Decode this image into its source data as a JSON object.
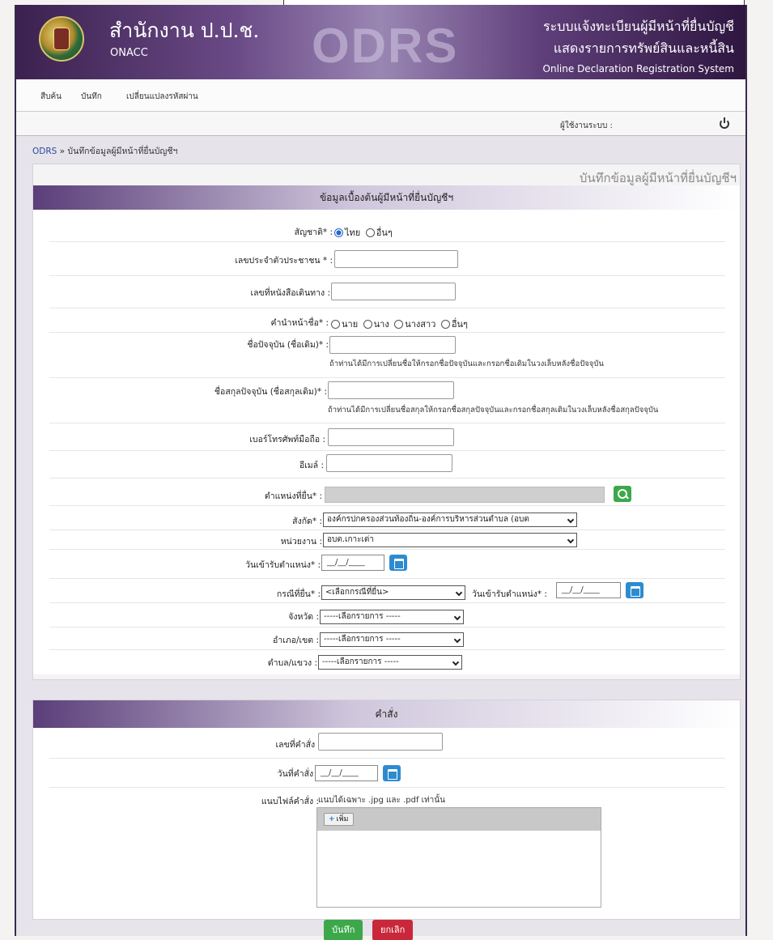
{
  "header": {
    "org_name": "สำนักงาน ป.ป.ช.",
    "org_abbr": "ONACC",
    "app_logo_text": "ODRS",
    "system_line1": "ระบบแจ้งทะเบียนผู้มีหน้าที่ยื่นบัญชี",
    "system_line2": "แสดงรายการทรัพย์สินและหนี้สิน",
    "system_line3": "Online Declaration Registration System"
  },
  "nav": {
    "items": [
      {
        "label": "สืบค้น"
      },
      {
        "label": "บันทึก"
      },
      {
        "label": "เปลี่ยนแปลงรหัสผ่าน"
      }
    ]
  },
  "userbar": {
    "user_label": "ผู้ใช้งานระบบ :"
  },
  "breadcrumb": {
    "home": "ODRS",
    "separator": " » ",
    "current": "บันทึกข้อมูลผู้มีหน้าที่ยื่นบัญชีฯ"
  },
  "page_title": "บันทึกข้อมูลผู้มีหน้าที่ยื่นบัญชีฯ",
  "section1": {
    "title": "ข้อมูลเบื้องต้นผู้มีหน้าที่ยื่นบัญชีฯ",
    "nationality_label": "สัญชาติ* :",
    "nationality_options": [
      "ไทย",
      "อื่นๆ"
    ],
    "id_label": "เลขประจำตัวประชาชน * :",
    "passport_label": "เลขที่หนังสือเดินทาง :",
    "prefix_label": "คำนำหน้าชื่อ* :",
    "prefix_options": [
      "นาย",
      "นาง",
      "นางสาว",
      "อื่นๆ"
    ],
    "firstname_label": "ชื่อปัจจุบัน (ชื่อเดิม)* :",
    "firstname_hint": "ถ้าท่านได้มีการเปลี่ยนชื่อให้กรอกชื่อปัจจุบันและกรอกชื่อเดิมในวงเล็บหลังชื่อปัจจุบัน",
    "lastname_label": "ชื่อสกุลปัจจุบัน (ชื่อสกุลเดิม)* :",
    "lastname_hint": "ถ้าท่านได้มีการเปลี่ยนชื่อสกุลให้กรอกชื่อสกุลปัจจุบันและกรอกชื่อสกุลเดิมในวงเล็บหลังชื่อสกุลปัจจุบัน",
    "mobile_label": "เบอร์โทรศัพท์มือถือ :",
    "email_label": "อีเมล์ :",
    "position_label": "ตำแหน่งที่ยื่น* :",
    "affiliation_label": "สังกัด* :",
    "affiliation_value": "องค์กรปกครองส่วนท้องถิ่น-องค์การบริหารส่วนตำบล (อบต",
    "unit_label": "หน่วยงาน :",
    "unit_value": "อบต.เกาะเต่า",
    "start_date_label": "วันเข้ารับตำแหน่ง* :",
    "date_placeholder": "__/__/____",
    "case_label": "กรณีที่ยื่น* :",
    "case_value": "<เลือกกรณีที่ยื่น>",
    "case_date_label": "วันเข้ารับตำแหน่ง* :",
    "province_label": "จังหวัด :",
    "district_label": "อำเภอ/เขต :",
    "subdistrict_label": "ตำบล/แขวง :",
    "select_default": "-----เลือกรายการ -----"
  },
  "section2": {
    "title": "คำสั่ง",
    "order_no_label": "เลขที่คำสั่ง :",
    "order_date_label": "วันที่คำสั่ง :",
    "attach_label": "แนบไฟล์คำสั่ง :",
    "attach_note": "แนบได้เฉพาะ .jpg และ .pdf เท่านั้น",
    "add_button": "เพิ่ม"
  },
  "actions": {
    "save": "บันทึก",
    "cancel": "ยกเลิก"
  },
  "colors": {
    "header_purple": "#5f3f7a",
    "save_green": "#3ca84a",
    "cancel_red": "#c9283a",
    "calendar_blue": "#2d8bd0"
  }
}
